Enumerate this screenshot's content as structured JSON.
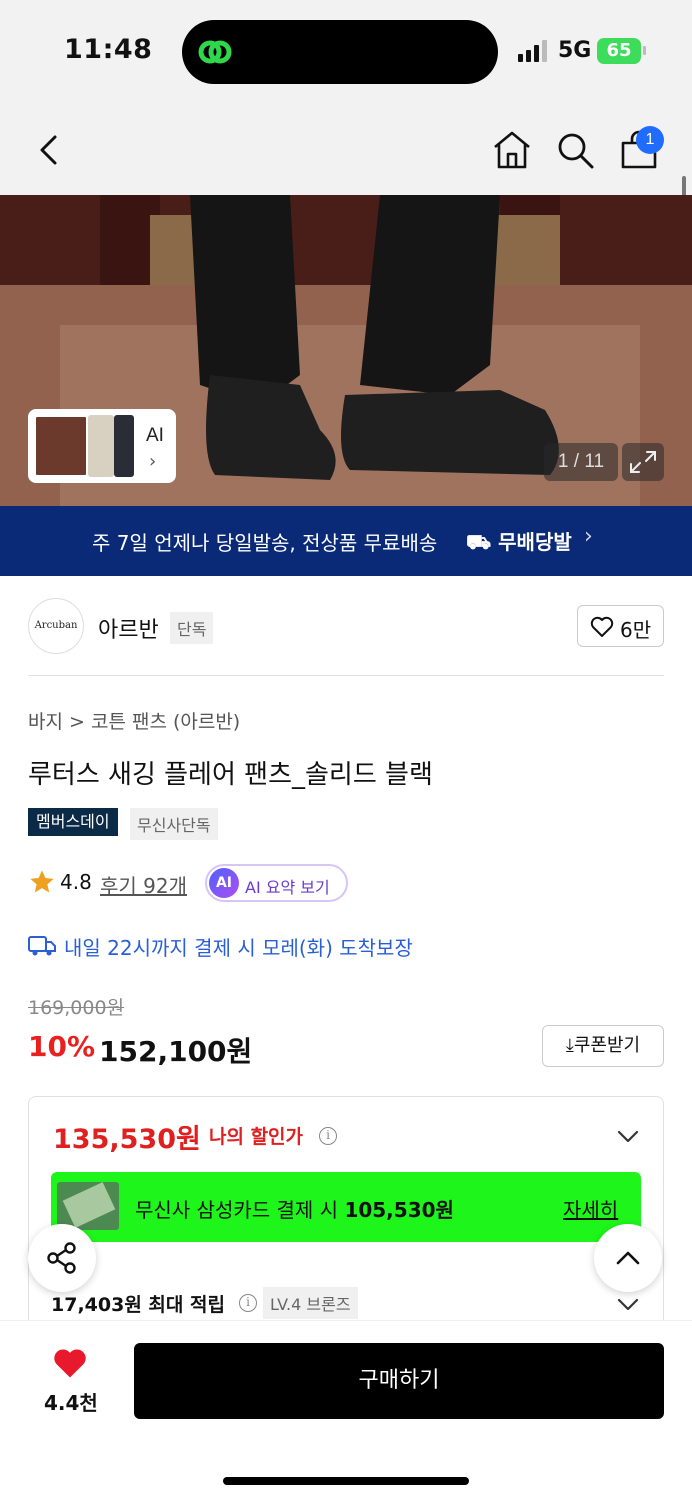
{
  "status": {
    "time": "11:48",
    "network": "5G",
    "battery": "65"
  },
  "nav": {
    "cart_count": "1"
  },
  "hero": {
    "counter": "1 / 11",
    "ai_label": "AI"
  },
  "banner": {
    "text": "주 7일 언제나 당일발송, 전상품 무료배송",
    "logo": "무배당발"
  },
  "brand": {
    "logo_text": "Arcuban",
    "name": "아르반",
    "badge": "단독",
    "likes": "6만"
  },
  "product": {
    "breadcrumb": "바지 > 코튼 팬츠 (아르반)",
    "title": "루터스 새깅 플레어 팬츠_솔리드 블랙",
    "tags": [
      "멤버스데이",
      "무신사단독"
    ],
    "rating": "4.8",
    "reviews": "후기 92개",
    "ai_summary": "AI 요약 보기",
    "ai_icon": "AI",
    "delivery": "내일 22시까지 결제 시 모레(화) 도착보장",
    "original_price": "169,000원",
    "discount": "10%",
    "price": "152,100원",
    "coupon": "쿠폰받기"
  },
  "my_price": {
    "price": "135,530원",
    "label": "나의 할인가",
    "card_text_prefix": "무신사 삼성카드 결제 시 ",
    "card_price": "105,530원",
    "card_link": "자세히",
    "reward": "17,403원 최대 적립",
    "tier": "LV.4 브론즈"
  },
  "bottom": {
    "likes": "4.4천",
    "buy": "구매하기"
  },
  "colors": {
    "banner": "#0a2a78",
    "discount": "#e82020",
    "promo": "#1ef51a",
    "delivery": "#2a5fd6"
  }
}
